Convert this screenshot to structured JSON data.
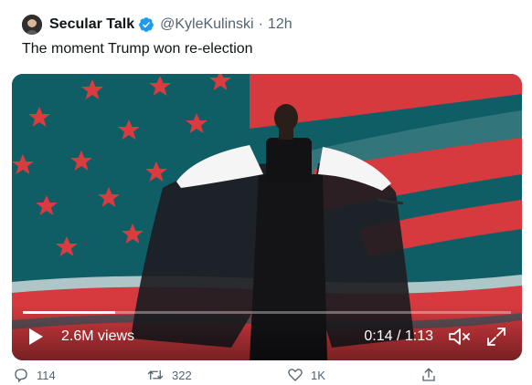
{
  "tweet": {
    "display_name": "Secular Talk",
    "handle": "@KyleKulinski",
    "separator": "·",
    "time": "12h",
    "text": "The moment Trump won re-election",
    "verified": true
  },
  "video": {
    "views": "2.6M views",
    "timecode": "0:14 / 1:13",
    "progress_fraction": 0.19
  },
  "actions": {
    "reply_count": "114",
    "retweet_count": "322",
    "like_count": "1K"
  },
  "icons": {
    "avatar": "avatar",
    "verified": "verified-badge-icon",
    "play": "play-icon",
    "mute": "speaker-muted-icon",
    "fullscreen": "fullscreen-icon",
    "reply": "reply-icon",
    "retweet": "retweet-icon",
    "like": "heart-icon",
    "share": "share-icon"
  },
  "colors": {
    "brand_blue": "#1d9bf0",
    "flag_red": "#d63a3f",
    "flag_teal": "#0f6b72",
    "star_red": "#d93b3f"
  }
}
